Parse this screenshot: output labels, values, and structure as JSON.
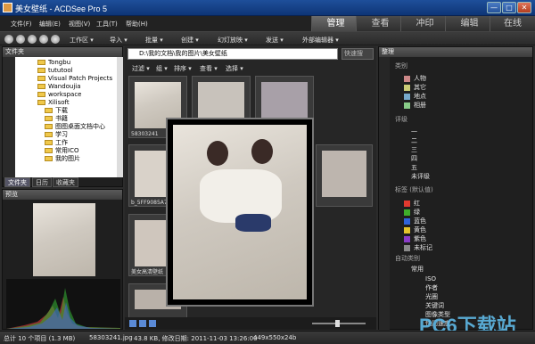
{
  "window": {
    "title": "美女壁纸 - ACDSee Pro 5",
    "min": "—",
    "max": "□",
    "close": "✕"
  },
  "menu": [
    "文件(F)",
    "编辑(E)",
    "视图(V)",
    "工具(T)",
    "帮助(H)"
  ],
  "modes": [
    "管理",
    "查看",
    "冲印",
    "编辑",
    "在线"
  ],
  "toolbar": [
    "工作区 ▾",
    "导入 ▾",
    "批量 ▾",
    "创建 ▾",
    "幻灯放映 ▾",
    "发送 ▾",
    "外部编辑器 ▾"
  ],
  "left_panel": {
    "title": "文件夹",
    "folders": [
      "Tongbu",
      "tututool",
      "Visual Patch Projects",
      "Wandoujia",
      "workspace",
      "Xilisoft",
      "下载",
      "书籍",
      "图图桌面文档中心",
      "学习",
      "工作",
      "常用ICO",
      "我的图片"
    ],
    "tabs": [
      "文件夹",
      "日历",
      "收藏夹"
    ]
  },
  "preview": {
    "title": "预览"
  },
  "center": {
    "path": "D:\\我的文档\\我的图片\\美女壁纸",
    "lock_label": "快速搜",
    "filters": [
      "过滤 ▾",
      "组 ▾",
      "排序 ▾",
      "查看 ▾",
      "选择 ▾"
    ],
    "thumb_captions": [
      "58303241",
      "b_5FF9085A7",
      "美女高清壁纸"
    ]
  },
  "right_panel": {
    "title": "整理",
    "category_header": "类别",
    "categories": [
      "人物",
      "其它",
      "地点",
      "相册"
    ],
    "rating_header": "评级",
    "ratings": [
      "一",
      "二",
      "三",
      "四",
      "五",
      "未评级"
    ],
    "label_header": "标签 (默认值)",
    "labels": [
      {
        "name": "红",
        "color": "#e03a2f"
      },
      {
        "name": "绿",
        "color": "#3fae2a"
      },
      {
        "name": "蓝色",
        "color": "#2f63d9"
      },
      {
        "name": "黄色",
        "color": "#e3c32b"
      },
      {
        "name": "紫色",
        "color": "#8a3bc7"
      },
      {
        "name": "未标记",
        "color": "#8a8a8a"
      }
    ],
    "auto_header": "自动类别",
    "auto_items": [
      "常用",
      "ISO",
      "作者",
      "光圈",
      "关键词",
      "图像类型",
      "快门速度",
      "文件大小"
    ]
  },
  "status": {
    "total": "总计 10 个项目 (1.3 MB)",
    "file": "58303241.jpg",
    "info": "43.8 KB, 修改日期: 2011-11-03 13:26:00",
    "dims": "449x550x24b"
  },
  "watermark": "PC6下载站"
}
